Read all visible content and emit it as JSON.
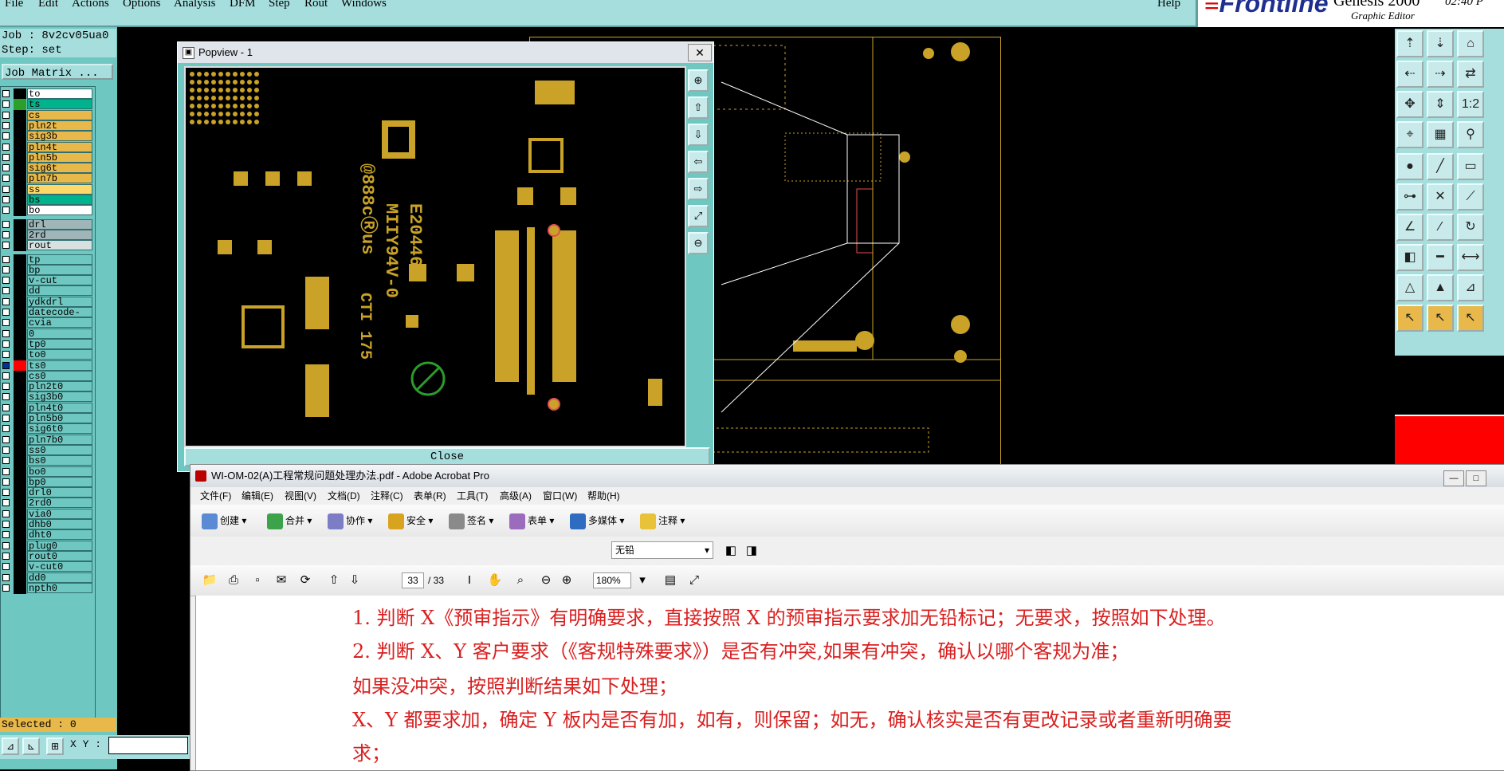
{
  "menubar": {
    "items": [
      "File",
      "Edit",
      "Actions",
      "Options",
      "Analysis",
      "DFM",
      "Step",
      "Rout",
      "Windows"
    ],
    "help": "Help"
  },
  "brand": {
    "logo": "Frontline",
    "product": "Genesis 2000",
    "subtitle": "Graphic Editor",
    "time": "02:40 P"
  },
  "left": {
    "job": "Job : 8v2cv05ua0",
    "step": "Step: set",
    "job_matrix": "Job Matrix ...",
    "selected": "Selected : 0",
    "xy_label": "X Y :",
    "layers": [
      {
        "name": "to",
        "color": "#ffffff",
        "swatch": "#000000",
        "sel": false
      },
      {
        "name": "ts",
        "color": "#00b38c",
        "swatch": "#2aa02a",
        "sel": false
      },
      {
        "name": "cs",
        "color": "#e8b84a",
        "swatch": "#000000",
        "sel": false
      },
      {
        "name": "pln2t",
        "color": "#e8b84a",
        "swatch": "#000000",
        "sel": false
      },
      {
        "name": "sig3b",
        "color": "#e8b84a",
        "swatch": "#000000",
        "sel": false
      },
      {
        "name": "pln4t",
        "color": "#e8b84a",
        "swatch": "#000000",
        "sel": false
      },
      {
        "name": "pln5b",
        "color": "#e8b84a",
        "swatch": "#000000",
        "sel": false
      },
      {
        "name": "sig6t",
        "color": "#e8b84a",
        "swatch": "#000000",
        "sel": false
      },
      {
        "name": "pln7b",
        "color": "#e8b84a",
        "swatch": "#000000",
        "sel": false
      },
      {
        "name": "ss",
        "color": "#ffd86b",
        "swatch": "#000000",
        "sel": false
      },
      {
        "name": "bs",
        "color": "#00b38c",
        "swatch": "#000000",
        "sel": false
      },
      {
        "name": "bo",
        "color": "#ffffff",
        "swatch": "#000000",
        "sel": false
      },
      {
        "name": "drl",
        "color": "#9fb5b8",
        "swatch": "#000000",
        "sel": false
      },
      {
        "name": "2rd",
        "color": "#9fb5b8",
        "swatch": "#000000",
        "sel": false
      },
      {
        "name": "rout",
        "color": "#d8e0e0",
        "swatch": "#000000",
        "sel": false
      },
      {
        "name": "tp",
        "color": "#6ec7c0",
        "swatch": "#000000",
        "sel": false
      },
      {
        "name": "bp",
        "color": "#6ec7c0",
        "swatch": "#000000",
        "sel": false
      },
      {
        "name": "v-cut",
        "color": "#6ec7c0",
        "swatch": "#000000",
        "sel": false
      },
      {
        "name": "dd",
        "color": "#6ec7c0",
        "swatch": "#000000",
        "sel": false
      },
      {
        "name": "ydkdrl",
        "color": "#6ec7c0",
        "swatch": "#000000",
        "sel": false
      },
      {
        "name": "datecode-ts",
        "color": "#6ec7c0",
        "swatch": "#000000",
        "sel": false
      },
      {
        "name": "cvia",
        "color": "#6ec7c0",
        "swatch": "#000000",
        "sel": false
      },
      {
        "name": "0",
        "color": "#6ec7c0",
        "swatch": "#000000",
        "sel": false
      },
      {
        "name": "tp0",
        "color": "#6ec7c0",
        "swatch": "#000000",
        "sel": false
      },
      {
        "name": "to0",
        "color": "#6ec7c0",
        "swatch": "#000000",
        "sel": false
      },
      {
        "name": "ts0",
        "color": "#6ec7c0",
        "swatch": "#ff0000",
        "sel": true
      },
      {
        "name": "cs0",
        "color": "#6ec7c0",
        "swatch": "#000000",
        "sel": false
      },
      {
        "name": "pln2t0",
        "color": "#6ec7c0",
        "swatch": "#000000",
        "sel": false
      },
      {
        "name": "sig3b0",
        "color": "#6ec7c0",
        "swatch": "#000000",
        "sel": false
      },
      {
        "name": "pln4t0",
        "color": "#6ec7c0",
        "swatch": "#000000",
        "sel": false
      },
      {
        "name": "pln5b0",
        "color": "#6ec7c0",
        "swatch": "#000000",
        "sel": false
      },
      {
        "name": "sig6t0",
        "color": "#6ec7c0",
        "swatch": "#000000",
        "sel": false
      },
      {
        "name": "pln7b0",
        "color": "#6ec7c0",
        "swatch": "#000000",
        "sel": false
      },
      {
        "name": "ss0",
        "color": "#6ec7c0",
        "swatch": "#000000",
        "sel": false
      },
      {
        "name": "bs0",
        "color": "#6ec7c0",
        "swatch": "#000000",
        "sel": false
      },
      {
        "name": "bo0",
        "color": "#6ec7c0",
        "swatch": "#000000",
        "sel": false
      },
      {
        "name": "bp0",
        "color": "#6ec7c0",
        "swatch": "#000000",
        "sel": false
      },
      {
        "name": "drl0",
        "color": "#6ec7c0",
        "swatch": "#000000",
        "sel": false
      },
      {
        "name": "2rd0",
        "color": "#6ec7c0",
        "swatch": "#000000",
        "sel": false
      },
      {
        "name": "via0",
        "color": "#6ec7c0",
        "swatch": "#000000",
        "sel": false
      },
      {
        "name": "dhb0",
        "color": "#6ec7c0",
        "swatch": "#000000",
        "sel": false
      },
      {
        "name": "dht0",
        "color": "#6ec7c0",
        "swatch": "#000000",
        "sel": false
      },
      {
        "name": "plug0",
        "color": "#6ec7c0",
        "swatch": "#000000",
        "sel": false
      },
      {
        "name": "rout0",
        "color": "#6ec7c0",
        "swatch": "#000000",
        "sel": false
      },
      {
        "name": "v-cut0",
        "color": "#6ec7c0",
        "swatch": "#000000",
        "sel": false
      },
      {
        "name": "dd0",
        "color": "#6ec7c0",
        "swatch": "#000000",
        "sel": false
      },
      {
        "name": "npth0",
        "color": "#6ec7c0",
        "swatch": "#000000",
        "sel": false
      }
    ]
  },
  "popview": {
    "title": "Popview - 1",
    "close_x": "✕",
    "close_label": "Close",
    "silk_lines": [
      "E204460",
      "MIIY94V-0",
      "@888cⓇus",
      "CTI 175"
    ]
  },
  "acrobat": {
    "title": "WI-OM-02(A)工程常规问题处理办法.pdf - Adobe Acrobat Pro",
    "menu": [
      "文件(F)",
      "编辑(E)",
      "视图(V)",
      "文档(D)",
      "注释(C)",
      "表单(R)",
      "工具(T)",
      "高级(A)",
      "窗口(W)",
      "帮助(H)"
    ],
    "toolbar": [
      "创建",
      "合并",
      "协作",
      "安全",
      "签名",
      "表单",
      "多媒体",
      "注释"
    ],
    "layer_select": "无铅",
    "page_current": "33",
    "page_total": "/ 33",
    "zoom": "180%",
    "doc_lines": [
      "1. 判断 X《预审指示》有明确要求，直接按照 X 的预审指示要求加无铅标记；无要求，按照如下处理。",
      "2. 判断 X、Y 客户要求（《客规特殊要求》）是否有冲突,如果有冲突，确认以哪个客规为准；",
      "如果没冲突，按照判断结果如下处理；",
      "X、Y 都要求加，确定 Y 板内是否有加，如有，则保留；如无，确认核实是否有更改记录或者重新明确要",
      "求；"
    ]
  },
  "colors": {
    "panel": "#a6dede",
    "panel_dark": "#6ec7c0",
    "copper": "#c9a227",
    "doc_text": "#d92020"
  }
}
